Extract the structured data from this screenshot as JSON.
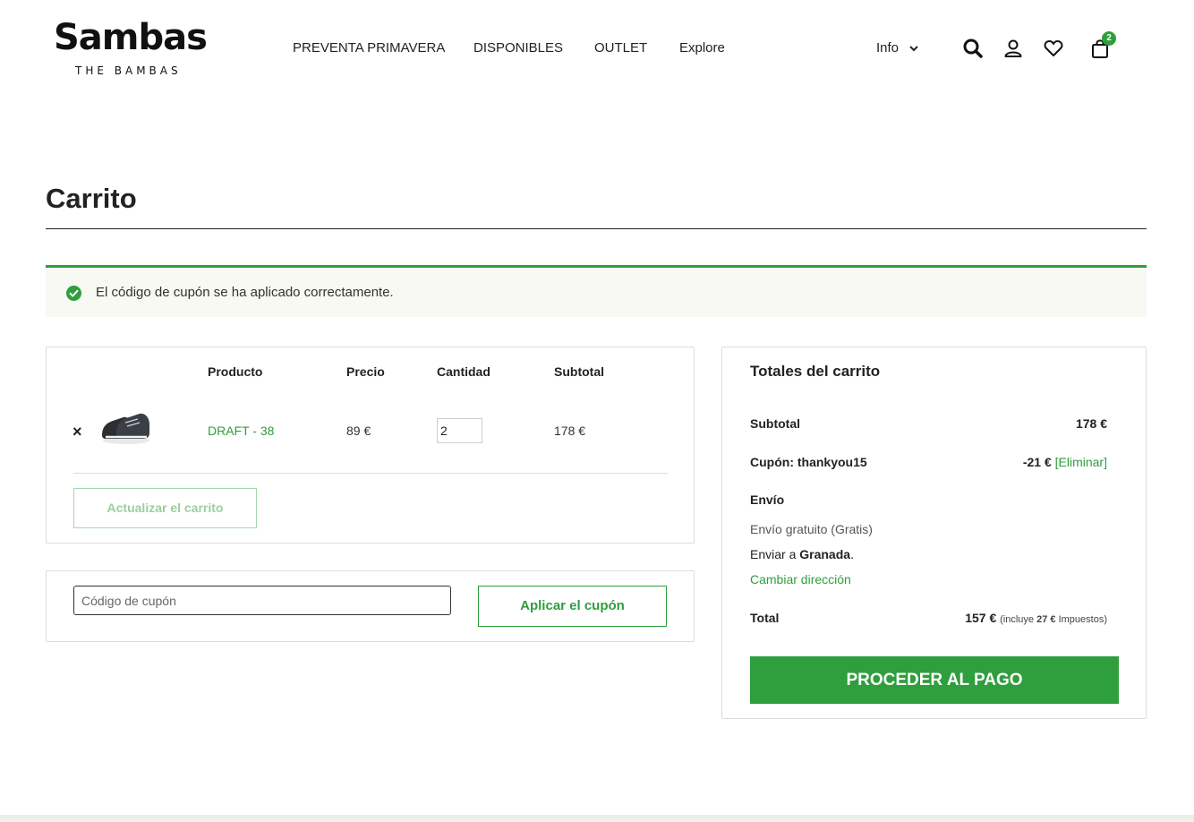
{
  "brand": {
    "logo_main": "Sambas",
    "logo_sub": "THE BAMBAS"
  },
  "nav": {
    "items": [
      "PREVENTA PRIMAVERA",
      "DISPONIBLES",
      "OUTLET",
      "Explore"
    ],
    "info_label": "Info"
  },
  "header_icons": [
    "search-icon",
    "user-icon",
    "heart-icon",
    "bag-icon"
  ],
  "cart_count": "2",
  "page": {
    "title": "Carrito"
  },
  "notice": {
    "text": "El código de cupón se ha aplicado correctamente."
  },
  "cart_table": {
    "headers": {
      "product": "Producto",
      "price": "Precio",
      "quantity": "Cantidad",
      "subtotal": "Subtotal"
    },
    "rows": [
      {
        "remove": "×",
        "product": "DRAFT - 38",
        "price": "89 €",
        "quantity": "2",
        "subtotal": "178 €"
      }
    ],
    "update_label": "Actualizar el carrito"
  },
  "coupon": {
    "placeholder": "Código de cupón",
    "apply_label": "Aplicar el cupón"
  },
  "totals": {
    "title": "Totales del carrito",
    "subtotal_label": "Subtotal",
    "subtotal_value": "178 €",
    "coupon_label": "Cupón: thankyou15",
    "coupon_value": "-21 €",
    "coupon_remove": "[Eliminar]",
    "shipping_label": "Envío",
    "shipping_method": "Envío gratuito (Gratis)",
    "ship_to_prefix": "Enviar a ",
    "ship_to_city": "Granada",
    "ship_to_suffix": ".",
    "change_address": "Cambiar dirección",
    "total_label": "Total",
    "total_value": "157 €",
    "tax_prefix": "(incluye ",
    "tax_value": "27 €",
    "tax_suffix": " Impuestos)",
    "checkout_label": "PROCEDER AL PAGO"
  },
  "colors": {
    "accent": "#2f9e3c",
    "notice_bg": "#f8f9f2",
    "border": "#dddddd"
  }
}
